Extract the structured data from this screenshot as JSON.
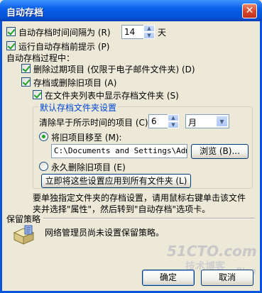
{
  "window": {
    "title": "自动存档",
    "close_glyph": "✕"
  },
  "autosave_interval": {
    "label": "自动存档时间间隔为 (R)",
    "value": "14",
    "unit": "天",
    "checked": true
  },
  "prompt_before": {
    "label": "运行自动存档前提示 (P)",
    "checked": true
  },
  "process_heading": "自动存档过程中：",
  "delete_expired": {
    "label": "删除过期项目 (仅限于电子邮件文件夹) (D)",
    "checked": true
  },
  "archive_or_delete": {
    "label": "存档或删除旧项目 (A)",
    "checked": true
  },
  "show_archive_folder": {
    "label": "在文件夹列表中显示存档文件夹 (S)",
    "checked": true
  },
  "defaults_group": {
    "title": "默认存档文件夹设置",
    "clean_label": "清除早于所示时间的项目 (C)",
    "clean_value": "6",
    "clean_unit": "月",
    "move_radio": {
      "label": "将旧项目移至 (M):",
      "checked": true
    },
    "path_value": "C:\\Documents and Settings\\Admin",
    "browse_label": "浏览 (B)...",
    "perm_delete_radio": {
      "label": "永久删除旧项目 (E)",
      "checked": false
    },
    "apply_all_label": "立即将这些设置应用到所有文件夹 (L)"
  },
  "hint_line1": "要单独指定文件夹的存档设置，请用鼠标右键单击该文件",
  "hint_line2": "夹并选择\"属性\"，然后转到\"自动存档\"选项卡。",
  "retention": {
    "heading": "保留策略",
    "text": "网络管理员尚未设置保留策略。"
  },
  "buttons": {
    "ok": "确定",
    "cancel": "取消"
  },
  "watermark": {
    "line1": "51CTO.com",
    "line2": "技术博客",
    "line3": "Blog"
  }
}
